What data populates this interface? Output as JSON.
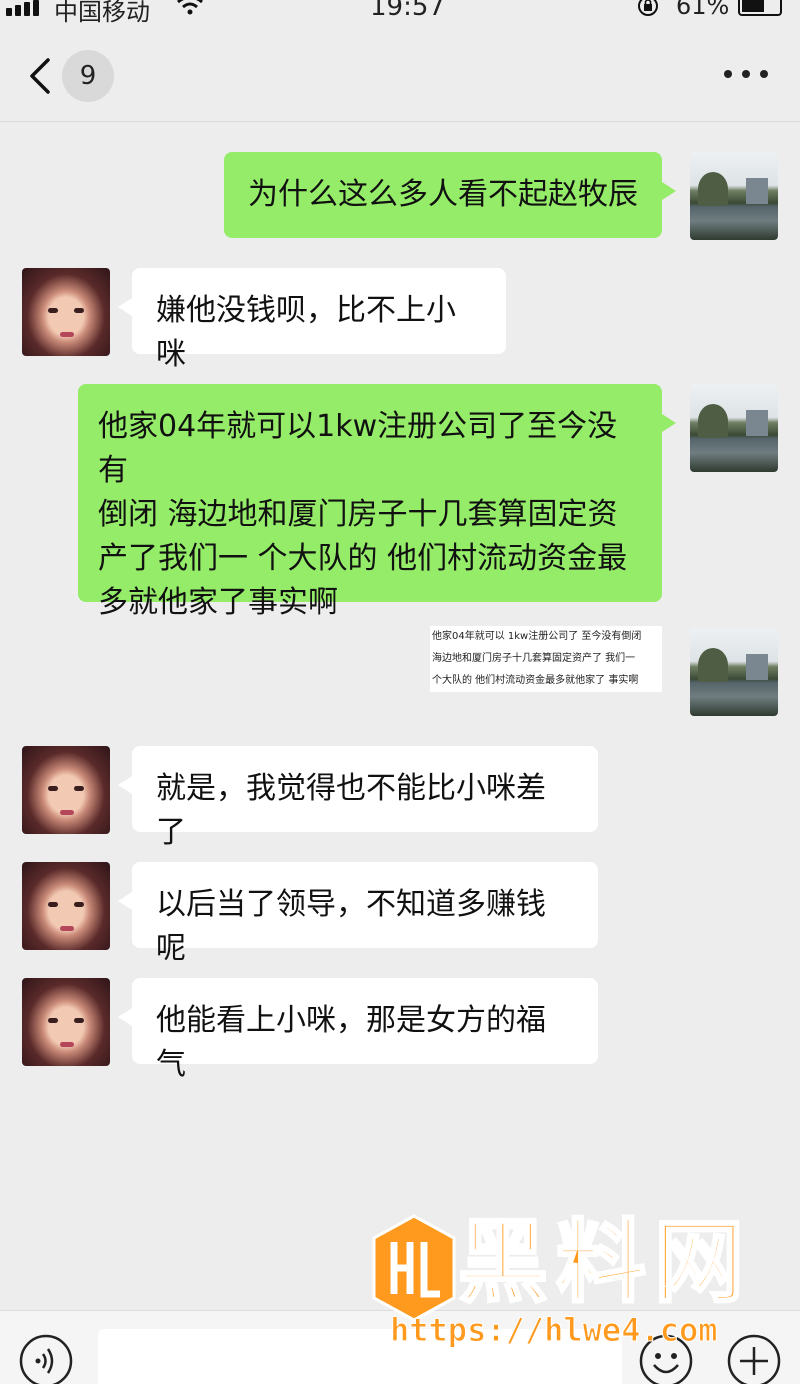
{
  "status_bar": {
    "carrier": "中国移动",
    "time": "19:57",
    "battery_percent": "61%",
    "battery_level": 0.61
  },
  "nav": {
    "unread_count": "9",
    "back_icon": "chevron-left-icon",
    "more_icon": "more-dots-icon"
  },
  "messages": [
    {
      "sender": "self",
      "avatar": "landscape-avatar",
      "text": "为什么这么多人看不起赵牧辰"
    },
    {
      "sender": "other",
      "avatar": "girl-avatar",
      "text": "嫌他没钱呗，比不上小咪"
    },
    {
      "sender": "self",
      "avatar": "landscape-avatar",
      "lines": [
        "他家04年就可以1kw注册公司了至今没有",
        "倒闭 海边地和厦门房子十几套算固定资",
        "产了我们一 个大队的 他们村流动资金最",
        "多就他家了事实啊"
      ]
    },
    {
      "sender": "self",
      "type": "image",
      "avatar": "landscape-avatar",
      "lines": [
        "他家04年就可以 1kw注册公司了 至今没有倒闭",
        "海边地和厦门房子十几套算固定资产了 我们一",
        "个大队的 他们村流动资金最多就他家了 事实啊"
      ]
    },
    {
      "sender": "other",
      "avatar": "girl-avatar",
      "text": "就是，我觉得也不能比小咪差了"
    },
    {
      "sender": "other",
      "avatar": "girl-avatar",
      "text": "以后当了领导，不知道多赚钱呢"
    },
    {
      "sender": "other",
      "avatar": "girl-avatar",
      "text": "他能看上小咪，那是女方的福气"
    }
  ],
  "input_bar": {
    "voice_icon": "voice-icon",
    "emoji_icon": "emoji-icon",
    "plus_icon": "plus-icon"
  },
  "watermark": {
    "name": "黑料网",
    "url": "https://hlwe4.com",
    "color": "#ff9a1e"
  },
  "colors": {
    "background": "#ededed",
    "outgoing_bubble": "#95ec69",
    "incoming_bubble": "#ffffff"
  }
}
